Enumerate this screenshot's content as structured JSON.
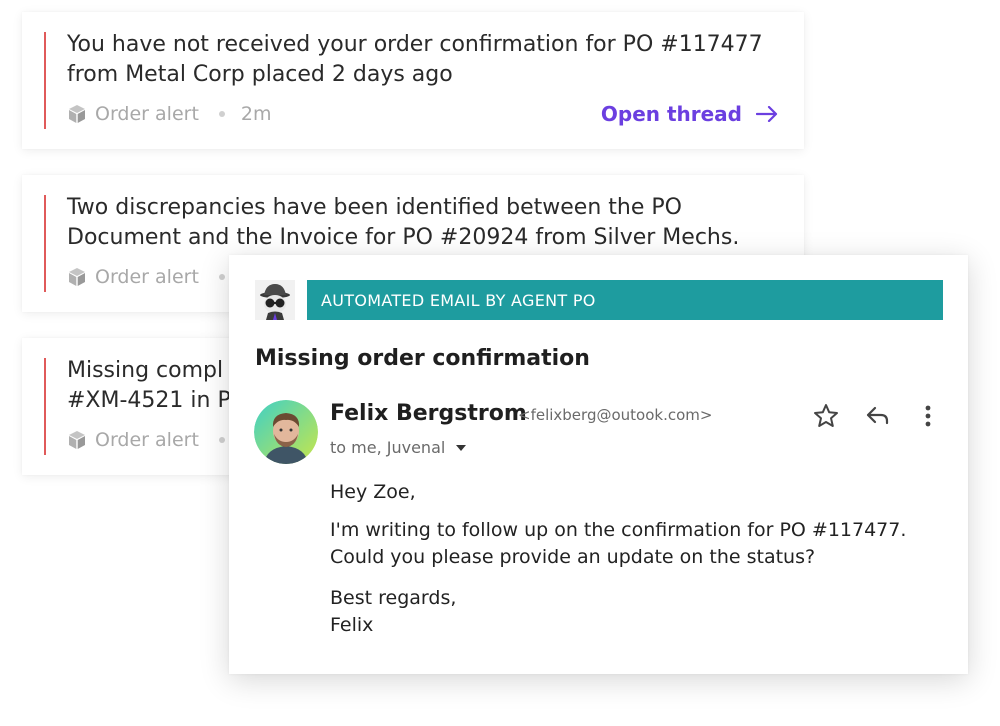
{
  "alerts": [
    {
      "message": "You have not received your order confirmation for PO #117477\nfrom Metal Corp placed 2 days ago",
      "type": "Order alert",
      "time": "2m",
      "action": "Open thread"
    },
    {
      "message": "Two discrepancies have been identified between the PO\nDocument and the Invoice for PO #20924 from Silver Mechs.",
      "type": "Order alert"
    },
    {
      "message": "Missing compl\n#XM-4521 in P",
      "type": "Order alert"
    }
  ],
  "email": {
    "banner": "AUTOMATED EMAIL BY AGENT PO",
    "subject": "Missing order confirmation",
    "sender_name": "Felix Bergstrom",
    "sender_email": "<felixberg@outook.com>",
    "recipients": "to me, Juvenal",
    "greeting": "Hey Zoe,",
    "body": "I'm writing to follow up on the confirmation for PO #117477.\nCould you please provide an update on the status?",
    "signoff": "Best regards,\nFelix"
  },
  "icons": {
    "alert_type": "cube-icon",
    "open_thread": "arrow-right-icon",
    "star": "star-icon",
    "reply": "reply-icon",
    "more": "more-vertical-icon",
    "recipients_toggle": "caret-down-icon"
  },
  "colors": {
    "alert_bar": "#e05a5a",
    "link": "#6b3fe0",
    "banner": "#1e9c9f"
  }
}
